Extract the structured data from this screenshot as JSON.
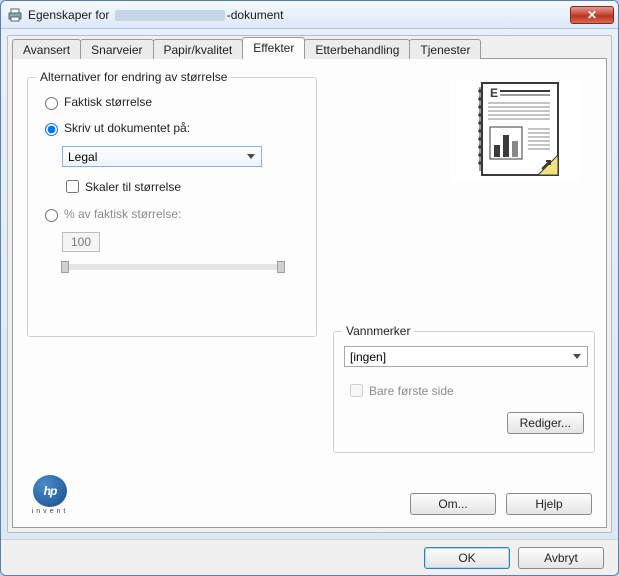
{
  "title_prefix": "Egenskaper for ",
  "title_suffix": "-dokument",
  "close_x": "✕",
  "tabs": {
    "t0": "Avansert",
    "t1": "Snarveier",
    "t2": "Papir/kvalitet",
    "t3": "Effekter",
    "t4": "Etterbehandling",
    "t5": "Tjenester"
  },
  "resize_group": {
    "title": "Alternativer for endring av størrelse",
    "actual": "Faktisk størrelse",
    "print_on": "Skriv ut dokumentet på:",
    "paper_select": "Legal",
    "scale_to_fit": "Skaler til størrelse",
    "percent": "% av faktisk størrelse:",
    "percent_value": "100"
  },
  "watermark_group": {
    "title": "Vannmerker",
    "select": "[ingen]",
    "first_only": "Bare første side",
    "edit": "Rediger..."
  },
  "hp": {
    "brand": "hp",
    "sub": "invent"
  },
  "buttons": {
    "about": "Om...",
    "help": "Hjelp",
    "ok": "OK",
    "cancel": "Avbryt"
  }
}
